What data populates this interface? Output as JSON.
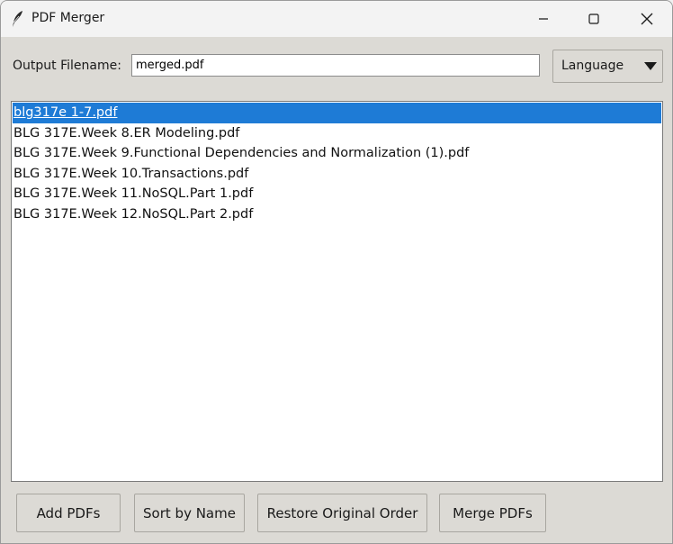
{
  "window": {
    "title": "PDF Merger"
  },
  "toolbar": {
    "output_label": "Output Filename:",
    "output_value": "merged.pdf",
    "language_label": "Language"
  },
  "files": [
    {
      "name": "blg317e 1-7.pdf",
      "selected": true
    },
    {
      "name": "BLG 317E.Week 8.ER Modeling.pdf",
      "selected": false
    },
    {
      "name": "BLG 317E.Week 9.Functional Dependencies and Normalization (1).pdf",
      "selected": false
    },
    {
      "name": "BLG 317E.Week 10.Transactions.pdf",
      "selected": false
    },
    {
      "name": "BLG 317E.Week 11.NoSQL.Part 1.pdf",
      "selected": false
    },
    {
      "name": "BLG 317E.Week 12.NoSQL.Part 2.pdf",
      "selected": false
    }
  ],
  "buttons": {
    "add": "Add PDFs",
    "sort": "Sort by Name",
    "restore": "Restore Original Order",
    "merge": "Merge PDFs"
  },
  "colors": {
    "selection": "#1e7bd6",
    "window_bg": "#dcdad5"
  },
  "icons": {
    "app": "feather-icon",
    "minimize": "minimize-icon",
    "maximize": "maximize-icon",
    "close": "close-icon",
    "dropdown": "dropdown-arrow-icon"
  }
}
